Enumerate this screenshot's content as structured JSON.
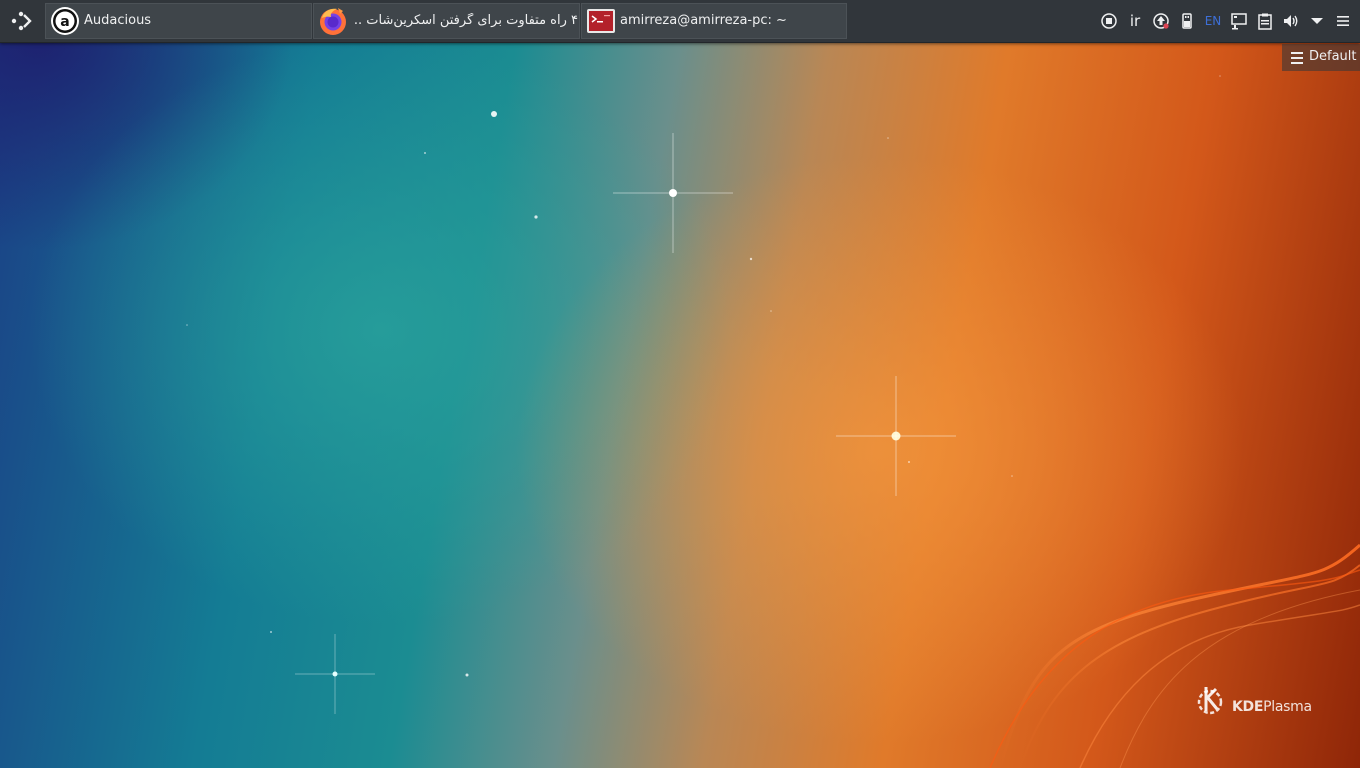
{
  "panel": {
    "launcher": {
      "icon": "application-launcher-icon"
    },
    "tasks": [
      {
        "name": "task-audacious",
        "icon": "audacious-icon",
        "label": "Audacious"
      },
      {
        "name": "task-firefox",
        "icon": "firefox-icon",
        "label": "۴ راه متفاوت برای گرفتن اسکرین‌شات ..."
      },
      {
        "name": "task-konsole",
        "icon": "terminal-icon",
        "label": "amirreza@amirreza-pc: ~"
      }
    ],
    "tray": {
      "items": [
        {
          "name": "media-stop-icon",
          "text": ""
        },
        {
          "name": "ir-indicator",
          "text": "ir"
        },
        {
          "name": "update-notifier-icon",
          "text": ""
        },
        {
          "name": "usb-device-icon",
          "text": ""
        },
        {
          "name": "keyboard-layout-indicator",
          "text": "EN"
        },
        {
          "name": "network-icon",
          "text": ""
        },
        {
          "name": "clipboard-icon",
          "text": ""
        },
        {
          "name": "volume-icon",
          "text": ""
        },
        {
          "name": "tray-expand-icon",
          "text": ""
        },
        {
          "name": "panel-options-icon",
          "text": ""
        }
      ],
      "en_color": "#3d6fd6"
    }
  },
  "desktop": {
    "toolbox_label": "Default",
    "logo": {
      "bold": "KDE",
      "text": "Plasma"
    }
  },
  "colors": {
    "panel": "#31363b",
    "task_bg": "#3f454a",
    "text": "#eff0f1"
  }
}
